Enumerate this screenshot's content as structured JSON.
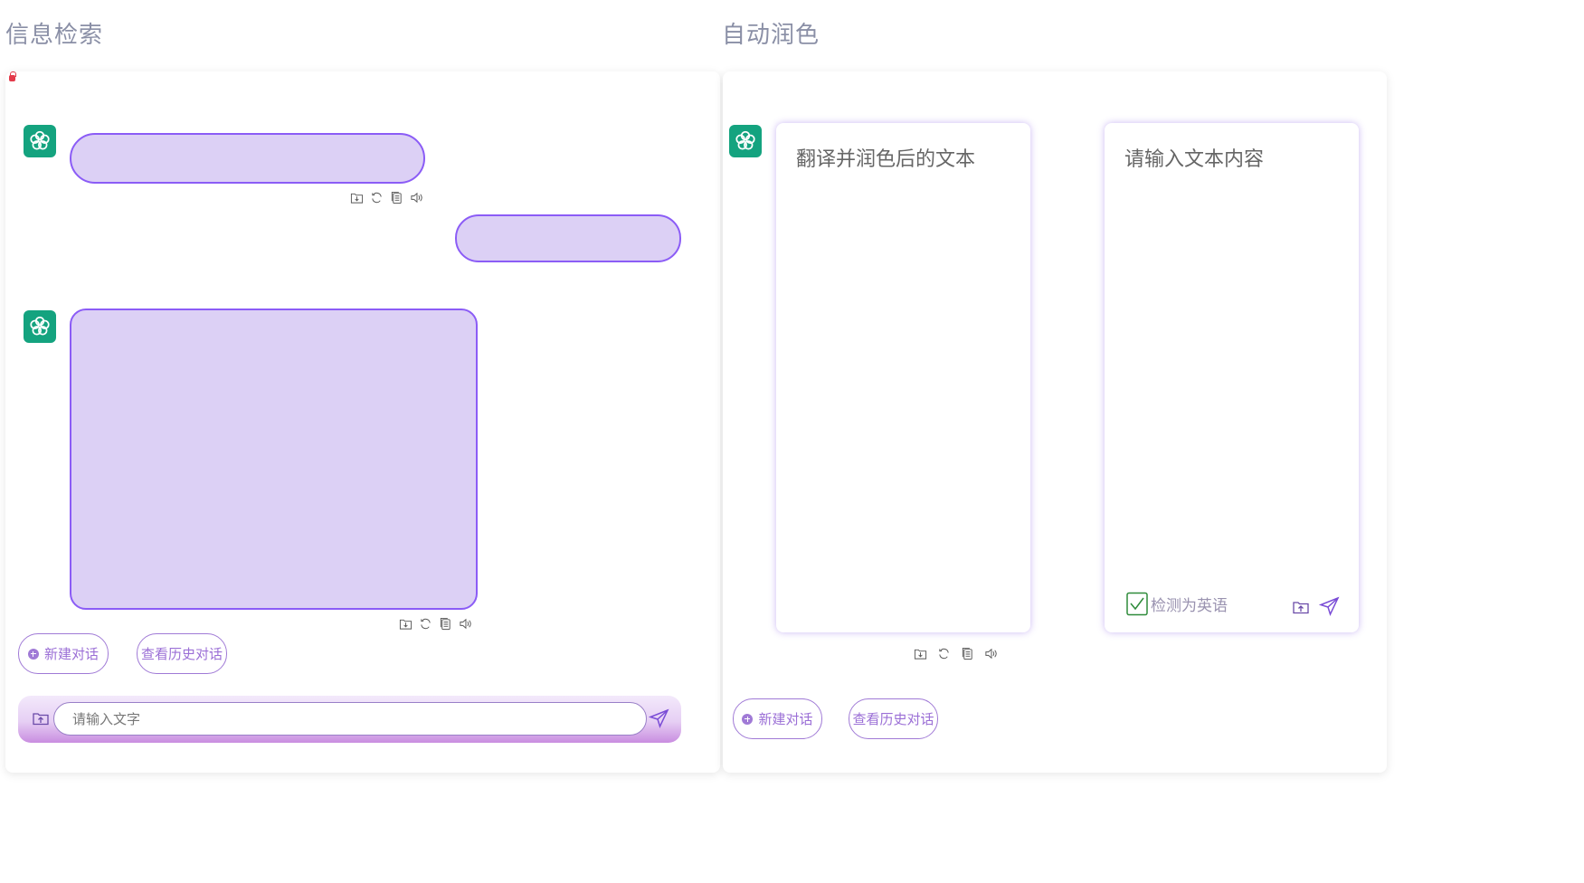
{
  "left_section": {
    "title": "信息检索",
    "new_chat_label": "新建对话",
    "history_label": "查看历史对话",
    "input": {
      "placeholder": "请输入文字",
      "value": ""
    }
  },
  "right_section": {
    "title": "自动润色",
    "output_card_text": "翻译并润色后的文本",
    "input_card_placeholder": "请输入文本内容",
    "detect_label": "检测为英语",
    "new_chat_label": "新建对话",
    "history_label": "查看历史对话"
  },
  "colors": {
    "accent": "#8b5cf6",
    "bubble_fill": "#dcd0f5",
    "avatar_green": "#14a37f",
    "button_text": "#9b6fd6"
  },
  "icons": {
    "avatar": "openai-logo-icon",
    "message_tools": [
      "save-icon",
      "refresh-icon",
      "copy-icon",
      "speaker-icon"
    ],
    "upload": "upload-folder-icon",
    "send": "send-icon",
    "detect": "checkbox-checked-icon"
  }
}
